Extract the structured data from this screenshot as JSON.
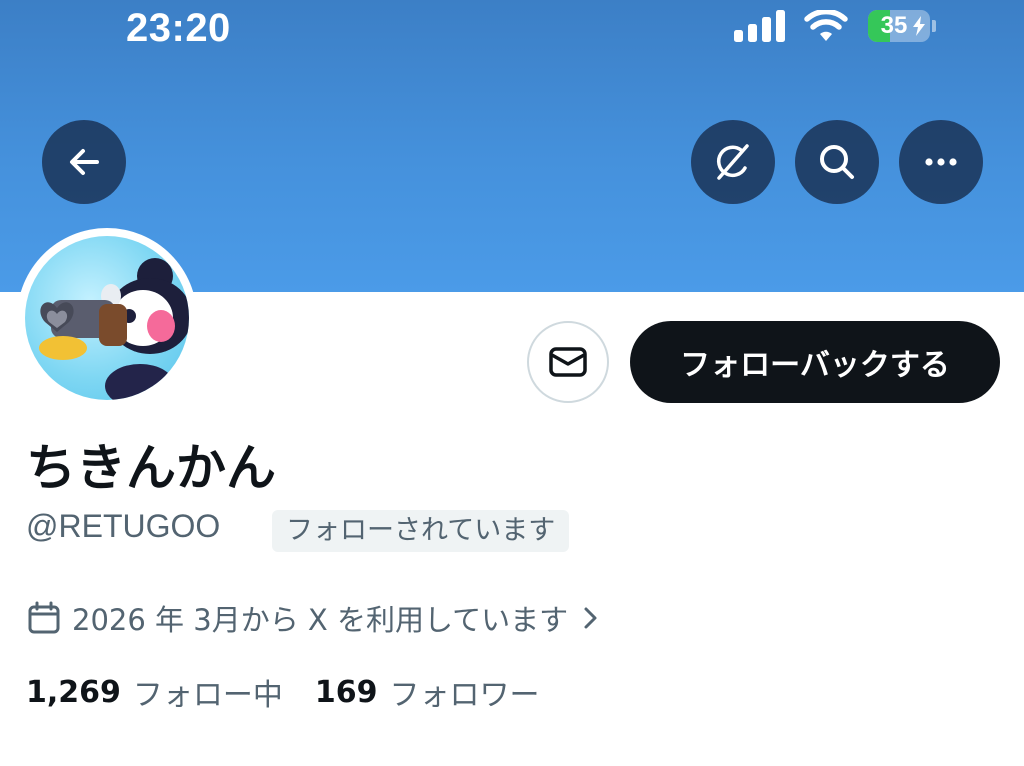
{
  "status_bar": {
    "time": "23:20",
    "battery_level": "35",
    "battery_fraction": 0.35,
    "battery_color": "#35c759"
  },
  "colors": {
    "banner": "#4591dc",
    "primary_text": "#0f1419",
    "secondary_text": "#536471",
    "button_dark": "#0f1419"
  },
  "header_buttons": {
    "back": {
      "icon": "arrow-left-icon"
    },
    "grok": {
      "icon": "grok-icon"
    },
    "search": {
      "icon": "search-icon"
    },
    "more": {
      "icon": "more-dots-icon"
    }
  },
  "profile": {
    "display_name": "ちきんかん",
    "handle": "@RETUGOO",
    "follows_you_badge": "フォローされています",
    "joined_text": "2026 年 3月から X を利用しています",
    "following_count": "1,269",
    "following_label": "フォロー中",
    "followers_count": "169",
    "followers_label": "フォロワー"
  },
  "actions": {
    "message_icon": "envelope-icon",
    "follow_back_label": "フォローバックする"
  }
}
